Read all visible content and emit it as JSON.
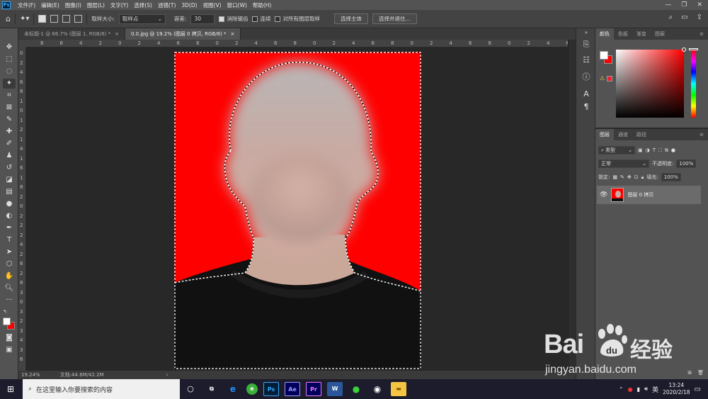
{
  "app": {
    "logo": "Ps"
  },
  "menu": [
    "文件(F)",
    "编辑(E)",
    "图像(I)",
    "图层(L)",
    "文字(Y)",
    "选择(S)",
    "滤镜(T)",
    "3D(D)",
    "视图(V)",
    "窗口(W)",
    "帮助(H)"
  ],
  "window_controls": [
    "minimize-icon",
    "restore-icon",
    "close-icon"
  ],
  "options": {
    "sample_size_label": "取样大小:",
    "sample_size_value": "取样点",
    "tolerance_label": "容差:",
    "tolerance_value": "30",
    "antialias_label": "消除锯齿",
    "contiguous_label": "连续",
    "sample_all_label": "对所有图层取样",
    "select_subject": "选择主体",
    "select_mask": "选择并遮住..."
  },
  "tabs": [
    {
      "label": "未标题-1 @ 66.7% (图层 1, RGB/8) *",
      "active": false
    },
    {
      "label": "0.0.jpg @ 19.2% (图层 0 拷贝, RGB/8) *",
      "active": true
    }
  ],
  "ruler_h": [
    "8",
    "6",
    "4",
    "2",
    "0",
    "2",
    "4",
    "6",
    "8",
    "0",
    "2",
    "4",
    "6",
    "8",
    "0",
    "2",
    "4",
    "6",
    "8",
    "0",
    "2",
    "4",
    "6",
    "8",
    "0",
    "2",
    "4",
    "6"
  ],
  "ruler_v": [
    "0",
    "2",
    "4",
    "6",
    "8",
    "1",
    "0",
    "1",
    "2",
    "1",
    "4",
    "1",
    "6",
    "1",
    "8",
    "2",
    "0",
    "2",
    "2",
    "2",
    "4",
    "2",
    "6",
    "2",
    "8",
    "3",
    "0",
    "3",
    "2",
    "3",
    "4",
    "3",
    "6"
  ],
  "status": {
    "zoom": "19.24%",
    "doc": "文档:44.6M/42.2M"
  },
  "color_panel": {
    "tabs": [
      "颜色",
      "色板",
      "渐变",
      "图案"
    ],
    "fg": "#ffffff",
    "bg": "#ff0000"
  },
  "layers_panel": {
    "tabs": [
      "图层",
      "通道",
      "路径"
    ],
    "filter_type": "类型",
    "blend_mode": "正常",
    "opacity_label": "不透明度:",
    "opacity_value": "100%",
    "lock_label": "锁定:",
    "fill_label": "填充:",
    "fill_value": "100%",
    "layer_name": "图层 0 拷贝"
  },
  "taskbar": {
    "search_placeholder": "在这里输入你要搜索的内容",
    "apps": [
      "Edge",
      "360",
      "Ps",
      "Ae",
      "Pr",
      "Word",
      "WeChat",
      "Media",
      "Explorer"
    ],
    "ime": "英",
    "time": "13:24",
    "date": "2020/2/18"
  },
  "watermark": {
    "brand": "Bai",
    "brand2": "经验",
    "url": "jingyan.baidu.com"
  },
  "colors": {
    "accent_ps": "#31a8ff",
    "photo_bg": "#ff0000"
  }
}
